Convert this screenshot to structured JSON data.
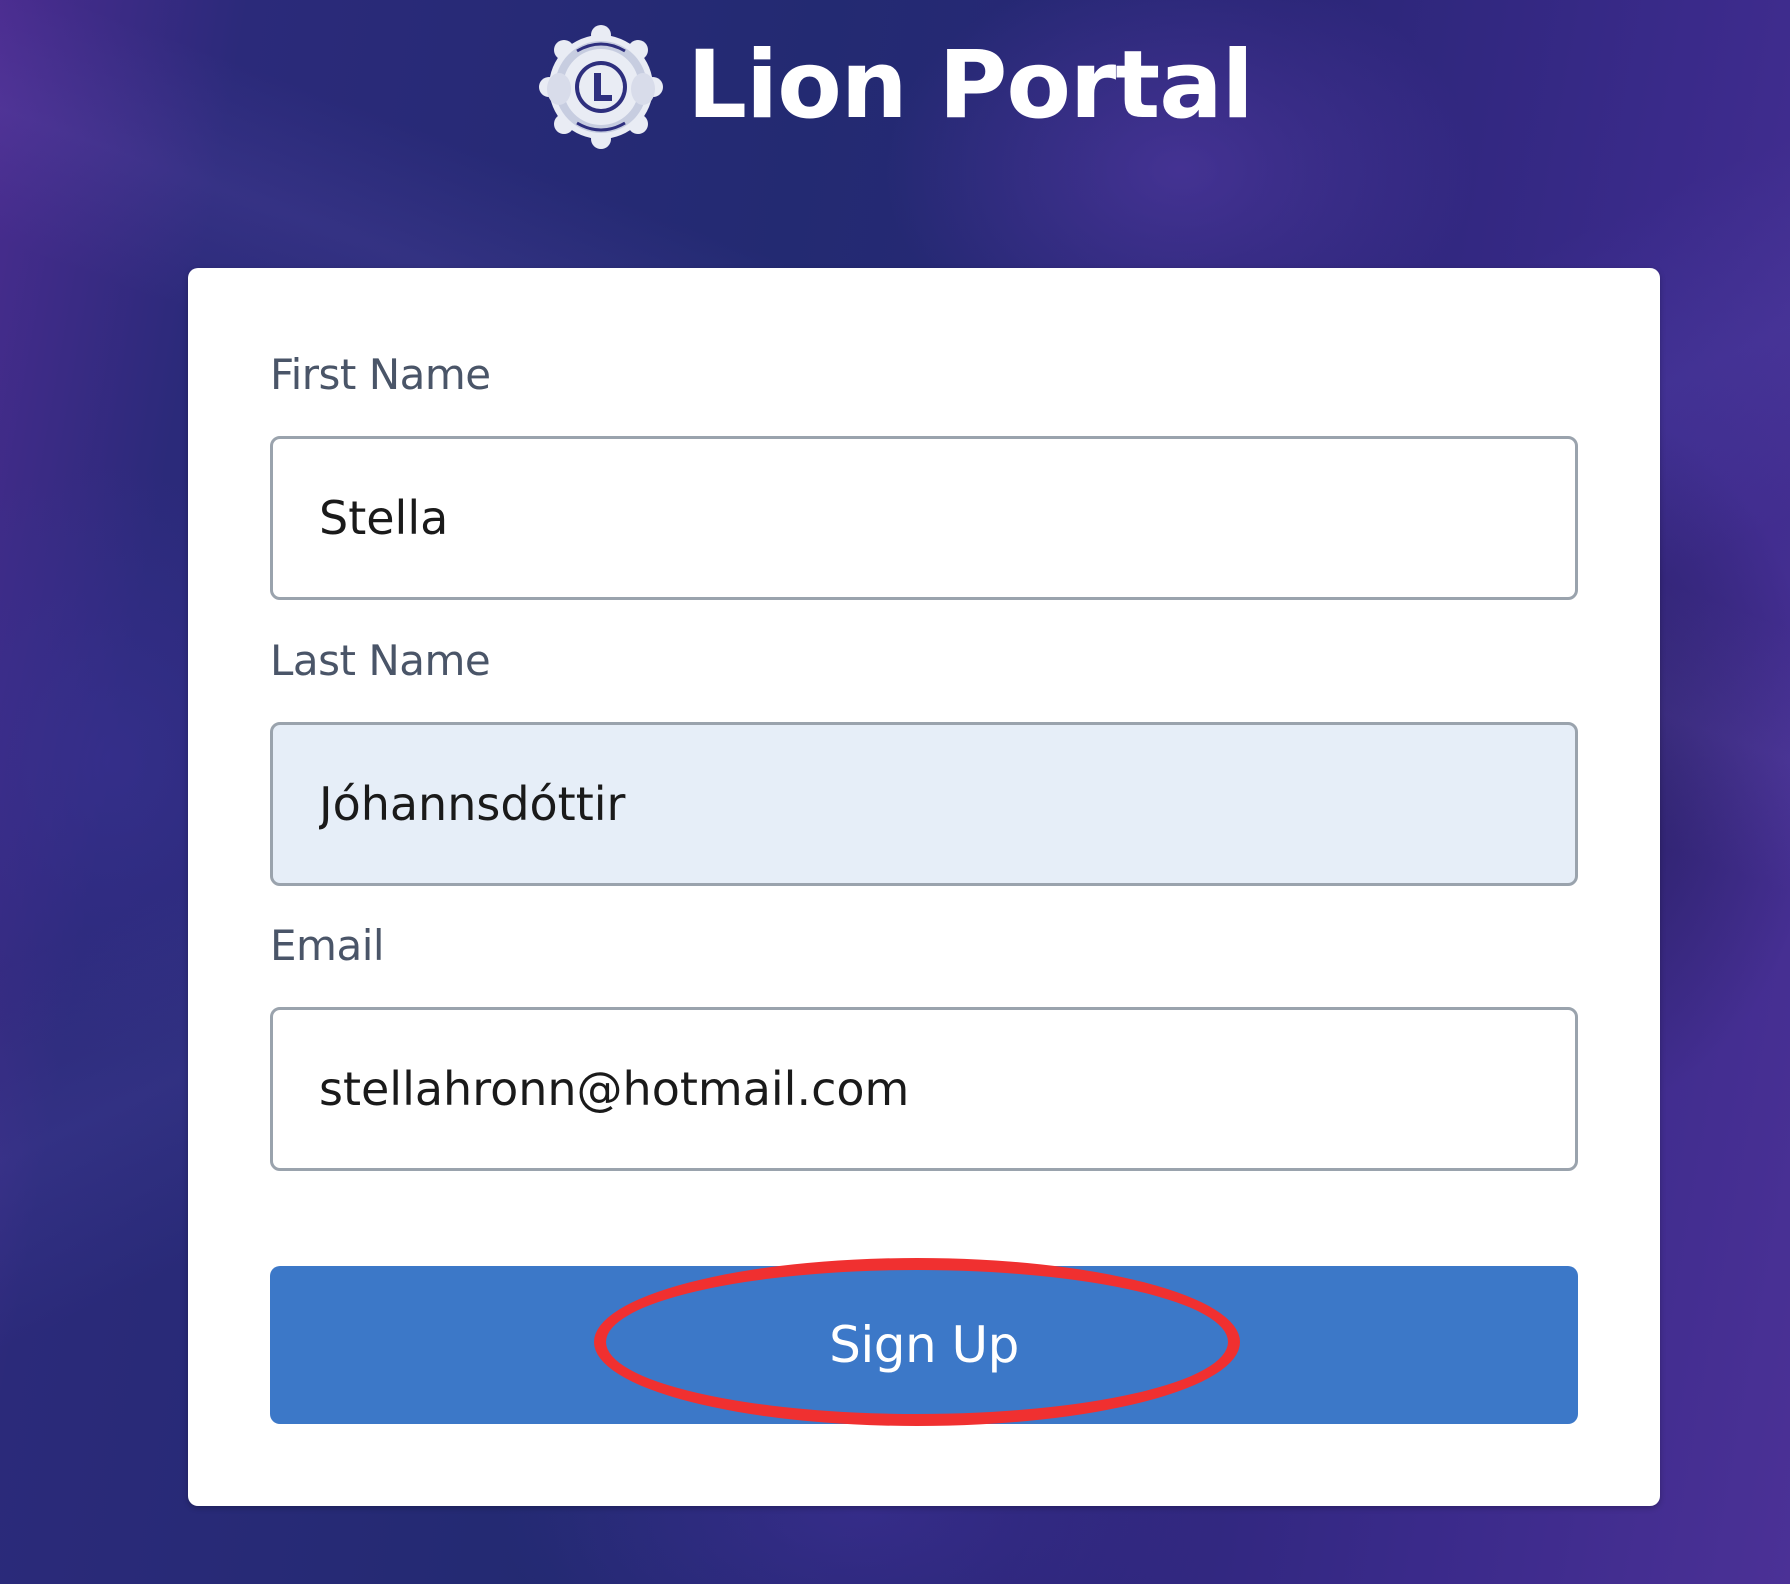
{
  "header": {
    "logo_icon": "lions-emblem-icon",
    "title": "Lion Portal"
  },
  "form": {
    "first_name": {
      "label": "First Name",
      "value": "Stella"
    },
    "last_name": {
      "label": "Last Name",
      "value": "Jóhannsdóttir"
    },
    "email": {
      "label": "Email",
      "value": "stellahronn@hotmail.com"
    },
    "submit_label": "Sign Up"
  },
  "annotation": {
    "type": "red-ellipse-highlight",
    "target": "signup-button",
    "color": "#f03030"
  },
  "colors": {
    "button": "#3c78c8",
    "autofill_field": "#e6eef8",
    "label_text": "#4a5568"
  }
}
